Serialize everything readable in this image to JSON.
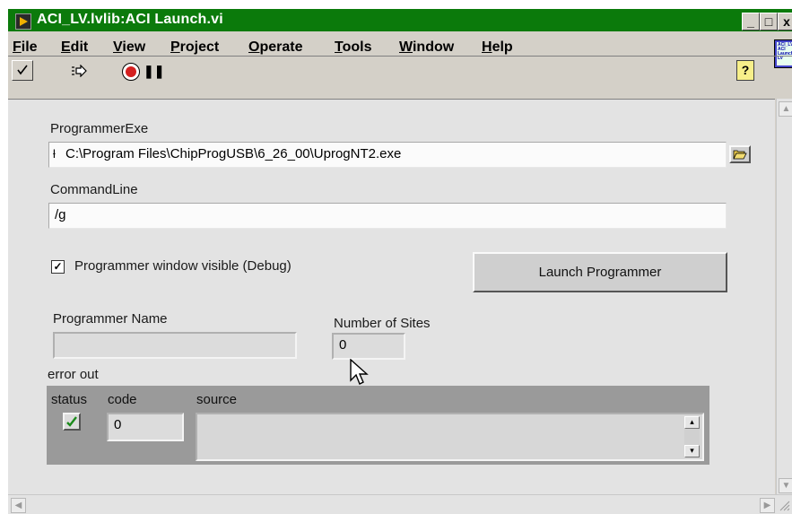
{
  "window": {
    "title": "ACI_LV.lvlib:ACI Launch.vi",
    "minimize_glyph": "_",
    "maximize_glyph": "□",
    "close_glyph": "x"
  },
  "menu": {
    "file": "File",
    "edit": "Edit",
    "view": "View",
    "project": "Project",
    "operate": "Operate",
    "tools": "Tools",
    "window": "Window",
    "help": "Help"
  },
  "toolbar": {
    "run_icon": "checkmark-icon",
    "run_continuous_icon": "run-continuously-icon",
    "abort_icon": "abort-icon",
    "pause_icon": "pause-icon",
    "help_icon": "context-help-icon",
    "help_glyph": "?"
  },
  "form": {
    "programmer_exe_label": "ProgrammerExe",
    "programmer_exe_prefix": "ƚ",
    "programmer_exe_value": "C:\\Program Files\\ChipProgUSB\\6_26_00\\UprogNT2.exe",
    "commandline_label": "CommandLine",
    "commandline_value": "/g",
    "debug_checkbox_label": "Programmer window visible (Debug)",
    "debug_checked": true,
    "launch_button_label": "Launch Programmer",
    "programmer_name_label": "Programmer Name",
    "programmer_name_value": "",
    "number_of_sites_label": "Number of Sites",
    "number_of_sites_value": "0"
  },
  "error_out": {
    "label": "error out",
    "status_label": "status",
    "code_label": "code",
    "source_label": "source",
    "code_value": "0",
    "status_ok": true,
    "source_value": ""
  },
  "colors": {
    "titlebar": "#0b7a0b",
    "panel_bg": "#e3e3e3",
    "window_bg": "#d4d0c8",
    "status_ok": "#1a8a1a"
  }
}
